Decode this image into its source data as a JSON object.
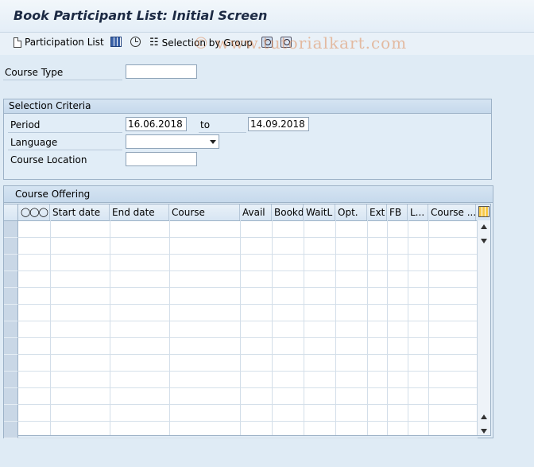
{
  "window": {
    "title": "Book Participant List: Initial Screen"
  },
  "toolbar": {
    "participation_list": "Participation List",
    "selection_by_group": "Selection by Group",
    "icons": [
      "document-icon",
      "grid-icon",
      "clock-icon",
      "tree-icon",
      "find-icon",
      "find-next-icon"
    ]
  },
  "watermark": "© www.tutorialkart.com",
  "course_type": {
    "label": "Course Type",
    "value": ""
  },
  "selection_criteria": {
    "title": "Selection Criteria",
    "period_label": "Period",
    "period_from": "16.06.2018",
    "to_label": "to",
    "period_to": "14.09.2018",
    "language_label": "Language",
    "language_value": "",
    "location_label": "Course Location",
    "location_value": ""
  },
  "course_offering": {
    "title": "Course Offering",
    "columns": [
      "ooo",
      "Start date",
      "End date",
      "Course",
      "Avail",
      "Bookd",
      "WaitL",
      "Opt.",
      "Ext",
      "FB",
      "L...",
      "Course ..."
    ],
    "rows": 13
  },
  "colors": {
    "background": "#dfebf5",
    "header": "#c6d9ec",
    "title": "#1c2a44"
  }
}
